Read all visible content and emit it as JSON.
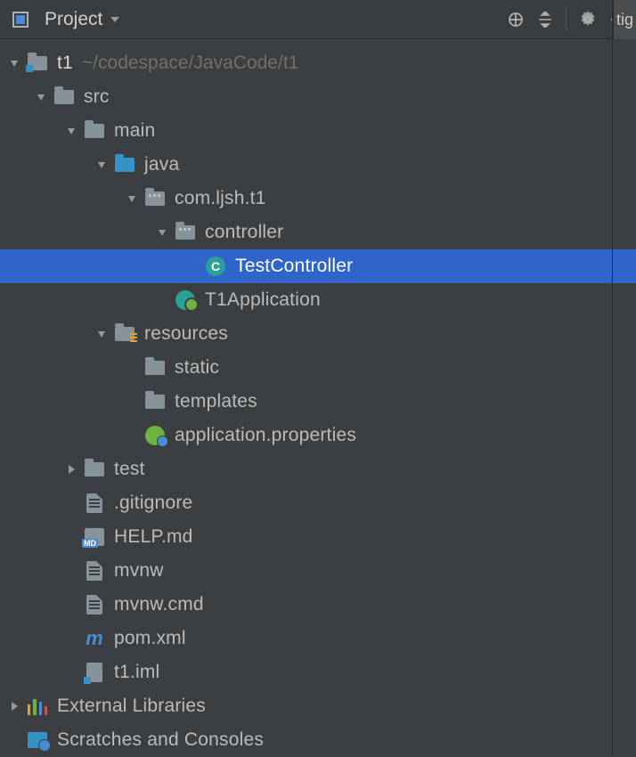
{
  "toolbar": {
    "title": "Project",
    "cutoff_text": "tig"
  },
  "tree": {
    "root": {
      "name": "t1",
      "path": "~/codespace/JavaCode/t1"
    },
    "src": "src",
    "main": "main",
    "java": "java",
    "pkg": "com.ljsh.t1",
    "controller": "controller",
    "test_controller": "TestController",
    "app_class": "T1Application",
    "resources": "resources",
    "static_dir": "static",
    "templates_dir": "templates",
    "app_props": "application.properties",
    "test_dir": "test",
    "gitignore": ".gitignore",
    "help_md": "HELP.md",
    "mvnw": "mvnw",
    "mvnw_cmd": "mvnw.cmd",
    "pom": "pom.xml",
    "iml": "t1.iml",
    "ext_lib": "External Libraries",
    "scratches": "Scratches and Consoles"
  }
}
